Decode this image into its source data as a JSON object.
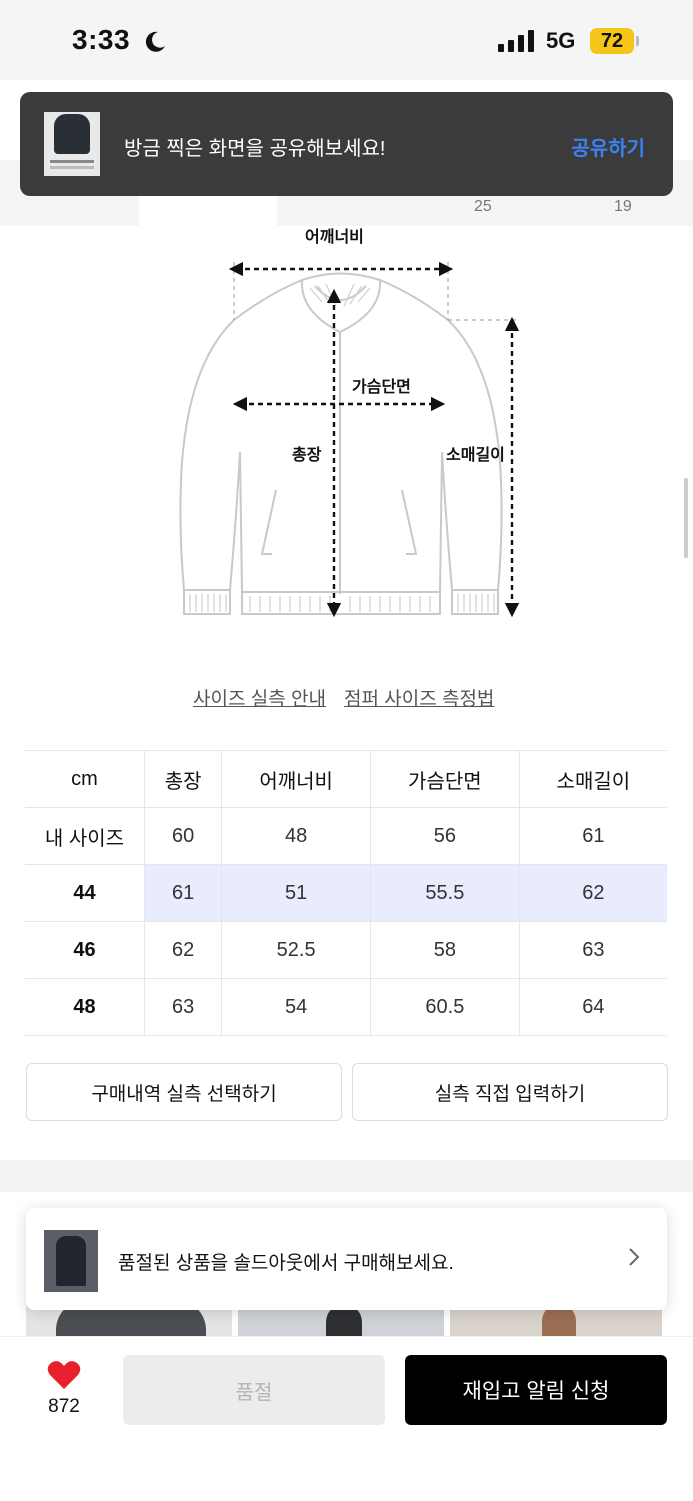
{
  "status_bar": {
    "time": "3:33",
    "network": "5G",
    "battery": "72"
  },
  "toast": {
    "message": "방금 찍은 화면을 공유해보세요!",
    "action": "공유하기"
  },
  "tabs": {
    "counts": [
      "25",
      "19"
    ]
  },
  "diagram": {
    "shoulder_label": "어깨너비",
    "chest_label": "가슴단면",
    "length_label": "총장",
    "sleeve_label": "소매길이"
  },
  "links": {
    "guide": "사이즈 실측 안내",
    "measure": "점퍼 사이즈 측정법"
  },
  "size_table": {
    "headers": [
      "cm",
      "총장",
      "어깨너비",
      "가슴단면",
      "소매길이"
    ],
    "rows": [
      {
        "label": "내 사이즈",
        "values": [
          "60",
          "48",
          "56",
          "61"
        ]
      },
      {
        "label": "44",
        "values": [
          "61",
          "51",
          "55.5",
          "62"
        ],
        "highlighted": true
      },
      {
        "label": "46",
        "values": [
          "62",
          "52.5",
          "58",
          "63"
        ]
      },
      {
        "label": "48",
        "values": [
          "63",
          "54",
          "60.5",
          "64"
        ]
      }
    ]
  },
  "actions": {
    "select_purchase": "구매내역 실측 선택하기",
    "manual_input": "실측 직접 입력하기"
  },
  "soldout_banner": {
    "text": "품절된 상품을 솔드아웃에서 구매해보세요."
  },
  "bottom_bar": {
    "like_count": "872",
    "soldout_label": "품절",
    "restock_label": "재입고 알림 신청"
  },
  "colors": {
    "highlight": "#e8ecfd",
    "link_blue": "#3b82f6",
    "battery": "#f5c518",
    "heart": "#e8202b"
  },
  "icons": [
    "moon-icon",
    "signal-icon",
    "heart-icon",
    "chevron-right-icon"
  ]
}
